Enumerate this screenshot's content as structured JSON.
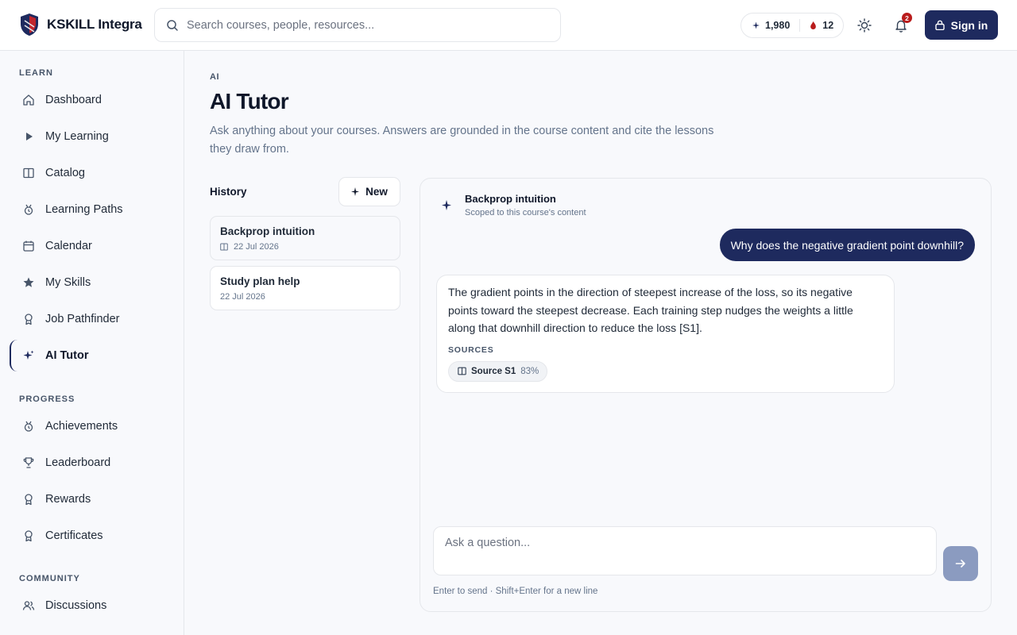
{
  "app": {
    "name": "KSKILL Integra"
  },
  "search": {
    "placeholder": "Search courses, people, resources..."
  },
  "stats": {
    "xp": "1,980",
    "streak": "12"
  },
  "notifications": {
    "count": "2"
  },
  "auth": {
    "signin_label": "Sign in"
  },
  "icons": {
    "search": "search-icon",
    "sparkle": "sparkle-icon",
    "flame": "flame-icon",
    "sun": "sun-icon",
    "bell": "bell-icon",
    "lock": "lock-icon",
    "send": "arrow-right-icon"
  },
  "colors": {
    "brand": "#1e2a5e",
    "badge": "#b91c1c",
    "send_disabled": "#8b9bc0"
  },
  "sidebar": {
    "sections": [
      {
        "label": "LEARN"
      },
      {
        "label": "PROGRESS"
      },
      {
        "label": "COMMUNITY"
      }
    ],
    "items": [
      {
        "label": "Dashboard"
      },
      {
        "label": "My Learning"
      },
      {
        "label": "Catalog"
      },
      {
        "label": "Learning Paths"
      },
      {
        "label": "Calendar"
      },
      {
        "label": "My Skills"
      },
      {
        "label": "Job Pathfinder"
      },
      {
        "label": "AI Tutor"
      },
      {
        "label": "Achievements"
      },
      {
        "label": "Leaderboard"
      },
      {
        "label": "Rewards"
      },
      {
        "label": "Certificates"
      },
      {
        "label": "Discussions"
      }
    ]
  },
  "page": {
    "breadcrumb": "AI",
    "title": "AI Tutor",
    "description": "Ask anything about your courses. Answers are grounded in the course content and cite the lessons they draw from."
  },
  "history": {
    "title": "History",
    "new_label": "New",
    "items": [
      {
        "title": "Backprop intuition",
        "date": "22 Jul 2026"
      },
      {
        "title": "Study plan help",
        "date": "22 Jul 2026"
      }
    ]
  },
  "chat": {
    "title": "Backprop intuition",
    "subtitle": "Scoped to this course's content",
    "user_message": "Why does the negative gradient point downhill?",
    "bot_message": "The gradient points in the direction of steepest increase of the loss, so its negative points toward the steepest decrease. Each training step nudges the weights a little along that downhill direction to reduce the loss [S1].",
    "sources_label": "SOURCES",
    "sources": [
      {
        "name": "Source S1",
        "score": "83%"
      }
    ],
    "input_placeholder": "Ask a question...",
    "hint": "Enter to send · Shift+Enter for a new line"
  }
}
